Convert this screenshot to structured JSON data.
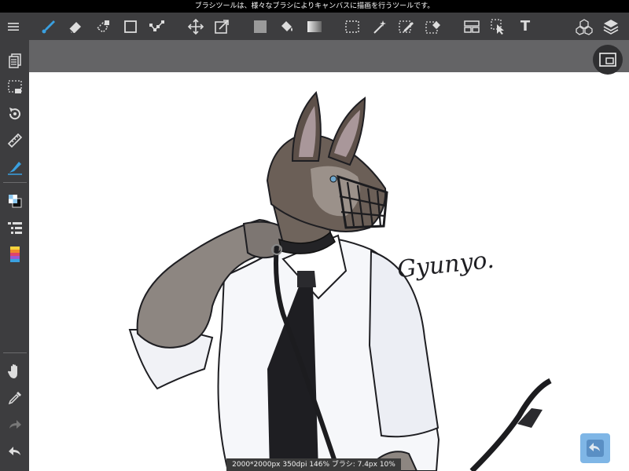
{
  "status_bar": {
    "message": "ブラシツールは、様々なブラシによりキャンバスに描画を行うツールです。"
  },
  "toolbar": {
    "items": [
      "menu-icon",
      "brush-icon",
      "eraser-icon",
      "lasso-eraser-icon",
      "rectangle-icon",
      "polyline-icon",
      "move-icon",
      "transform-icon",
      "fill-color-icon",
      "bucket-icon",
      "gradient-icon",
      "select-rectangle-icon",
      "magic-wand-icon",
      "select-pen-icon",
      "select-eraser-icon",
      "frame-divide-icon",
      "select-layer-icon",
      "text-tool-icon",
      "materials-icon",
      "layers-icon"
    ],
    "text_tool_glyph": "T"
  },
  "sidebar": {
    "items": [
      "page-manager-icon",
      "selection-icon",
      "rotate-view-icon",
      "ruler-icon",
      "snap-icon",
      "color-swatch-icon",
      "brush-list-icon",
      "color-palette-icon",
      "hand-icon",
      "eyedropper-icon",
      "redo-icon",
      "undo-icon"
    ]
  },
  "canvas": {
    "signature": "Gyunyo."
  },
  "info_bar": {
    "text": "2000*2000px 350dpi 146% ブラシ: 7.4px 10%"
  },
  "colors": {
    "accent": "#3aa0e0",
    "toolbar_bg": "#3d3d3f",
    "canvas_bg": "#ffffff"
  }
}
